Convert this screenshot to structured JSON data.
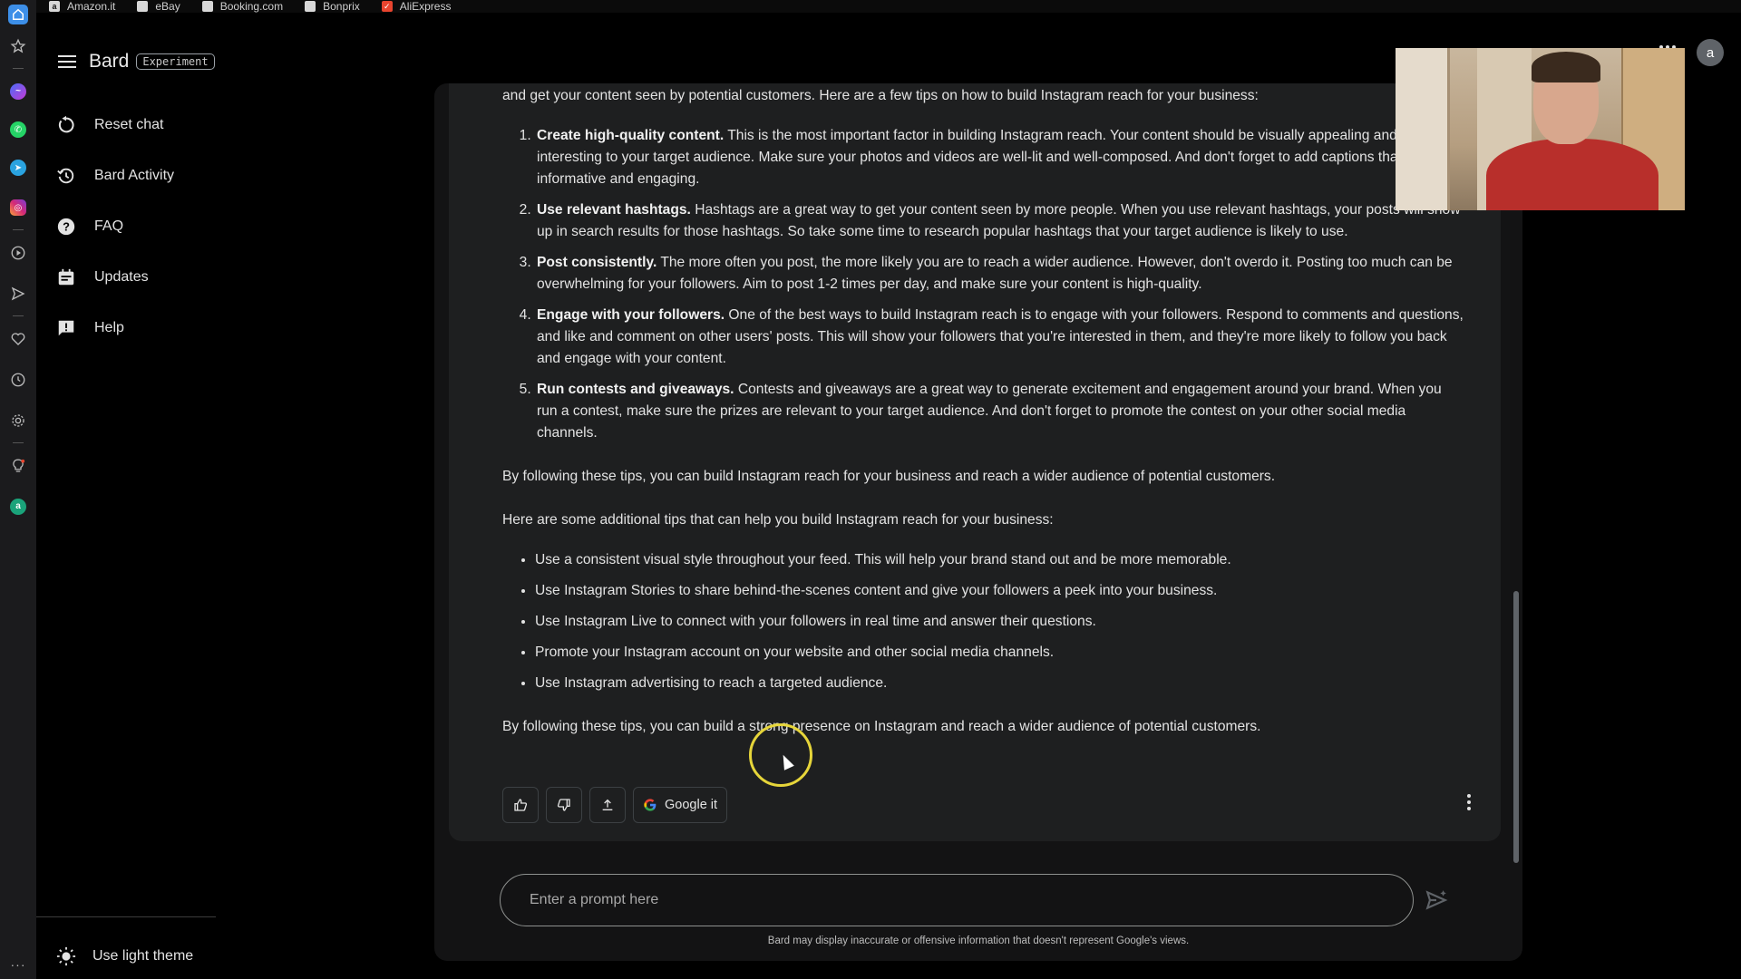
{
  "bookmarks": [
    {
      "label": "Amazon.it",
      "icon": "amazon-icon",
      "glyph": "a"
    },
    {
      "label": "eBay",
      "icon": "page-icon",
      "glyph": ""
    },
    {
      "label": "Booking.com",
      "icon": "page-icon",
      "glyph": ""
    },
    {
      "label": "Bonprix",
      "icon": "page-icon",
      "glyph": ""
    },
    {
      "label": "AliExpress",
      "icon": "aliexpress-icon",
      "glyph": "✓"
    }
  ],
  "app": {
    "title": "Bard",
    "badge": "Experiment",
    "avatar_letter": "a"
  },
  "nav": {
    "items": [
      {
        "label": "Reset chat",
        "icon": "reset-icon"
      },
      {
        "label": "Bard Activity",
        "icon": "history-icon"
      },
      {
        "label": "FAQ",
        "icon": "help-circle-icon"
      },
      {
        "label": "Updates",
        "icon": "calendar-icon"
      },
      {
        "label": "Help",
        "icon": "feedback-icon"
      }
    ],
    "light_theme": "Use light theme"
  },
  "response": {
    "intro": "and get your content seen by potential customers. Here are a few tips on how to build Instagram reach for your business:",
    "tips": [
      {
        "title": "Create high-quality content.",
        "body": " This is the most important factor in building Instagram reach. Your content should be visually appealing and interesting to your target audience. Make sure your photos and videos are well-lit and well-composed. And don't forget to add captions that are informative and engaging."
      },
      {
        "title": "Use relevant hashtags.",
        "body": " Hashtags are a great way to get your content seen by more people. When you use relevant hashtags, your posts will show up in search results for those hashtags. So take some time to research popular hashtags that your target audience is likely to use."
      },
      {
        "title": "Post consistently.",
        "body": " The more often you post, the more likely you are to reach a wider audience. However, don't overdo it. Posting too much can be overwhelming for your followers. Aim to post 1-2 times per day, and make sure your content is high-quality."
      },
      {
        "title": "Engage with your followers.",
        "body": " One of the best ways to build Instagram reach is to engage with your followers. Respond to comments and questions, and like and comment on other users' posts. This will show your followers that you're interested in them, and they're more likely to follow you back and engage with your content."
      },
      {
        "title": "Run contests and giveaways.",
        "body": " Contests and giveaways are a great way to generate excitement and engagement around your brand. When you run a contest, make sure the prizes are relevant to your target audience. And don't forget to promote the contest on your other social media channels."
      }
    ],
    "summary1": "By following these tips, you can build Instagram reach for your business and reach a wider audience of potential customers.",
    "additional_intro": "Here are some additional tips that can help you build Instagram reach for your business:",
    "bullets": [
      "Use a consistent visual style throughout your feed. This will help your brand stand out and be more memorable.",
      "Use Instagram Stories to share behind-the-scenes content and give your followers a peek into your business.",
      "Use Instagram Live to connect with your followers in real time and answer their questions.",
      "Promote your Instagram account on your website and other social media channels.",
      "Use Instagram advertising to reach a targeted audience."
    ],
    "summary2": "By following these tips, you can build a strong presence on Instagram and reach a wider audience of potential customers.",
    "google_it": "Google it"
  },
  "prompt": {
    "placeholder": "Enter a prompt here",
    "disclaimer": "Bard may display inaccurate or offensive information that doesn't represent Google's views."
  },
  "colors": {
    "accent_blue": "#3d8fe8",
    "cursor_ring": "#e6d53a",
    "aliexpress_red": "#e8442e"
  }
}
